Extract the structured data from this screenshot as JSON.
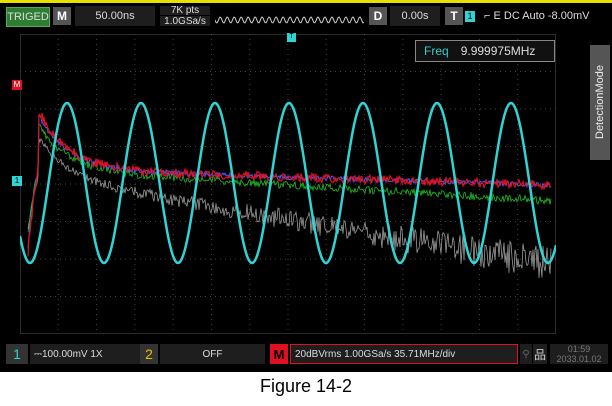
{
  "header": {
    "trig_status": "TRIGED",
    "menu_m": "M",
    "timebase": "50.00ns",
    "points": "7K pts",
    "sample_rate": "1.0GSa/s",
    "delay_btn": "D",
    "delay": "0.00s",
    "trigger_btn": "T",
    "trigger_ch": "1",
    "trigger_info": "⌐ E DC Auto -8.00mV"
  },
  "freq": {
    "label": "Freq",
    "value": "9.999975MHz"
  },
  "side_tab": "DetectionMode",
  "markers": {
    "ch1": "1",
    "math": "M",
    "trigger": "T"
  },
  "footer": {
    "ch1_num": "1",
    "ch1_info": "⎓100.00mV 1X",
    "ch2_num": "2",
    "ch2_info": "OFF",
    "math_num": "M",
    "math_info": "20dBVrms  1.00GSa/s  35.71MHz/div",
    "time": "01:59",
    "date": "2033.01.02"
  },
  "caption": "Figure 14-2",
  "colors": {
    "ch1": "#2fd4d4",
    "math": "#e01020",
    "green": "#20c020",
    "gray": "#999999",
    "trig": "#e8e000"
  }
}
